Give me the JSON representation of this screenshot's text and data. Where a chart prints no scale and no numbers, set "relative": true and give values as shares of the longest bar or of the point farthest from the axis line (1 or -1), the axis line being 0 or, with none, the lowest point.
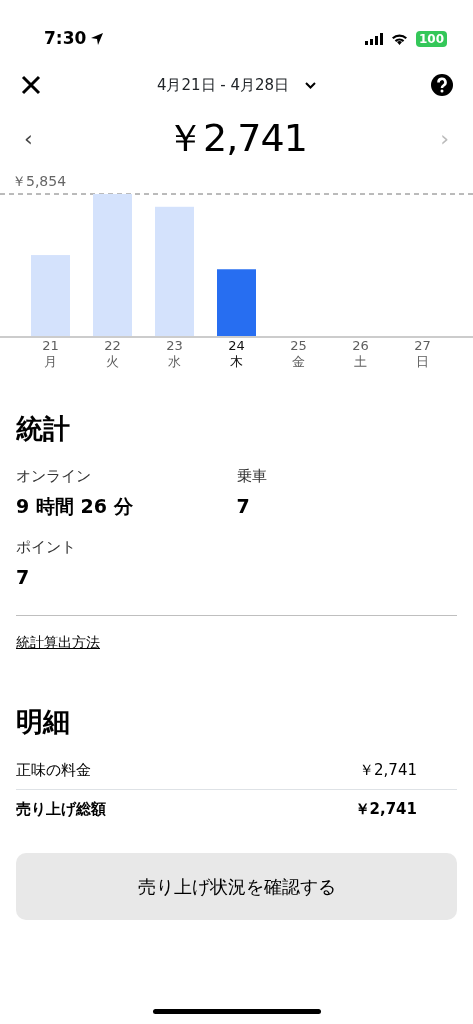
{
  "status_bar": {
    "time": "7:30",
    "battery": "100"
  },
  "header": {
    "date_range": "4月21日 - 4月28日",
    "prev_icon": "‹",
    "prev_enabled": true,
    "next_icon": "›",
    "next_enabled": false
  },
  "total": "￥2,741",
  "chart": {
    "chart_data": {
      "type": "bar",
      "categories": [
        "21",
        "22",
        "23",
        "24",
        "25",
        "26",
        "27"
      ],
      "values": [
        0.57,
        1,
        0.91,
        0.47,
        null,
        null,
        null
      ],
      "relative": true,
      "annotations": [
        {
          "text": "￥5,854"
        }
      ]
    },
    "weekdays": [
      "月",
      "火",
      "水",
      "木",
      "金",
      "土",
      "日"
    ],
    "selected": [
      false,
      false,
      false,
      true,
      false,
      false,
      false
    ]
  },
  "stats": {
    "title": "統計",
    "items": [
      {
        "label": "オンライン",
        "value": "9 時間 26 分"
      },
      {
        "label": "乗車",
        "value": "7"
      },
      {
        "label": "ポイント",
        "value": "7"
      }
    ],
    "link": "統計算出方法"
  },
  "breakdown": {
    "title": "明細",
    "rows": [
      {
        "label": "正味の料金",
        "value": "￥2,741",
        "bold": false
      },
      {
        "label": "売り上げ総額",
        "value": "￥2,741",
        "bold": true
      }
    ]
  },
  "button": "売り上げ状況を確認する"
}
